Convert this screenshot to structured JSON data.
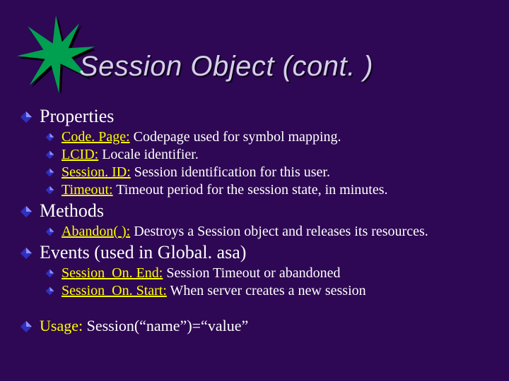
{
  "icons": {
    "starburst_color": "#00a050",
    "starburst_shadow": "#000000",
    "bullet_color": "#3030c0",
    "bullet_highlight": "#9090ff"
  },
  "title": "Session Object (cont. )",
  "sections": [
    {
      "heading": "Properties",
      "items": [
        {
          "term": "Code. Page:",
          "desc": " Codepage used for symbol mapping."
        },
        {
          "term": "LCID:",
          "desc": " Locale identifier."
        },
        {
          "term": "Session. ID:",
          "desc": " Session identification for this user."
        },
        {
          "term": "Timeout:",
          "desc": " Timeout period for the session state, in minutes."
        }
      ]
    },
    {
      "heading": "Methods",
      "items": [
        {
          "term": "Abandon( ):",
          "desc": " Destroys a Session object and releases its resources."
        }
      ]
    },
    {
      "heading": "Events (used  in  Global. asa)",
      "items": [
        {
          "term": "Session_On. End:",
          "desc": " Session Timeout or abandoned"
        },
        {
          "term": "Session_On. Start:",
          "desc": " When server creates a new session"
        }
      ]
    }
  ],
  "usage": {
    "label": "Usage:",
    "code": " Session(“name”)=“value”"
  }
}
